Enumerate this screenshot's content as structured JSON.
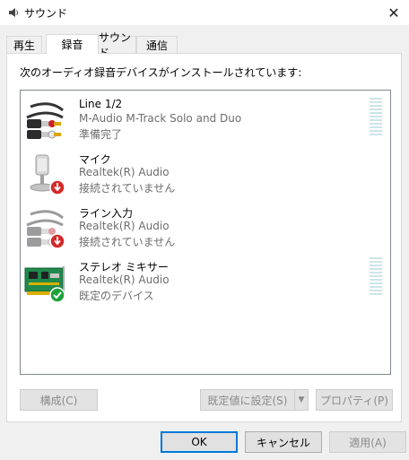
{
  "window": {
    "title": "サウンド"
  },
  "tabs": [
    {
      "label": "再生"
    },
    {
      "label": "録音"
    },
    {
      "label": "サウンド"
    },
    {
      "label": "通信"
    }
  ],
  "instruction": "次のオーディオ録音デバイスがインストールされています:",
  "devices": [
    {
      "name": "Line 1/2",
      "driver": "M-Audio M-Track Solo and Duo",
      "status": "準備完了",
      "icon": "rca-cable-icon"
    },
    {
      "name": "マイク",
      "driver": "Realtek(R) Audio",
      "status": "接続されていません",
      "icon": "microphone-icon"
    },
    {
      "name": "ライン入力",
      "driver": "Realtek(R) Audio",
      "status": "接続されていません",
      "icon": "rca-cable-icon"
    },
    {
      "name": "ステレオ ミキサー",
      "driver": "Realtek(R) Audio",
      "status": "既定のデバイス",
      "icon": "sound-card-icon"
    }
  ],
  "buttons": {
    "configure": "構成(C)",
    "set_default": "既定値に設定(S)",
    "properties": "プロパティ(P)",
    "ok": "OK",
    "cancel": "キャンセル",
    "apply": "適用(A)"
  },
  "colors": {
    "accent": "#0078d7",
    "ok_badge": "#1aa23a",
    "disconnected_badge": "#d42a2a"
  }
}
